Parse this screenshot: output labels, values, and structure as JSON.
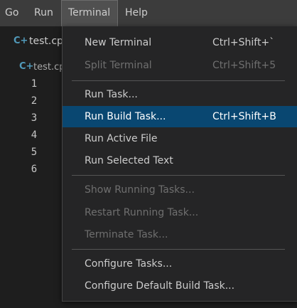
{
  "menubar": {
    "items": [
      {
        "label": "Go"
      },
      {
        "label": "Run"
      },
      {
        "label": "Terminal"
      },
      {
        "label": "Help"
      }
    ]
  },
  "editor": {
    "tab_label": "test.cpp",
    "breadcrumb_label": "test.cpp",
    "line_numbers": [
      "1",
      "2",
      "3",
      "4",
      "5",
      "6"
    ],
    "file_icon_glyph": "C+",
    "file_icon_color": "#519aba"
  },
  "terminal_menu": {
    "items": [
      {
        "label": "New Terminal",
        "shortcut": "Ctrl+Shift+`",
        "enabled": true
      },
      {
        "label": "Split Terminal",
        "shortcut": "Ctrl+Shift+5",
        "enabled": false
      },
      {
        "label": "Run Task...",
        "shortcut": "",
        "enabled": true
      },
      {
        "label": "Run Build Task...",
        "shortcut": "Ctrl+Shift+B",
        "enabled": true,
        "highlighted": true
      },
      {
        "label": "Run Active File",
        "shortcut": "",
        "enabled": true
      },
      {
        "label": "Run Selected Text",
        "shortcut": "",
        "enabled": true
      },
      {
        "label": "Show Running Tasks...",
        "shortcut": "",
        "enabled": false
      },
      {
        "label": "Restart Running Task...",
        "shortcut": "",
        "enabled": false
      },
      {
        "label": "Terminate Task...",
        "shortcut": "",
        "enabled": false
      },
      {
        "label": "Configure Tasks...",
        "shortcut": "",
        "enabled": true
      },
      {
        "label": "Configure Default Build Task...",
        "shortcut": "",
        "enabled": true
      }
    ]
  },
  "colors": {
    "menubar_bg": "#3c3c3c",
    "menu_bg": "#252526",
    "highlight_bg": "#094771",
    "text": "#cccccc",
    "disabled_text": "#6f6f6f"
  }
}
